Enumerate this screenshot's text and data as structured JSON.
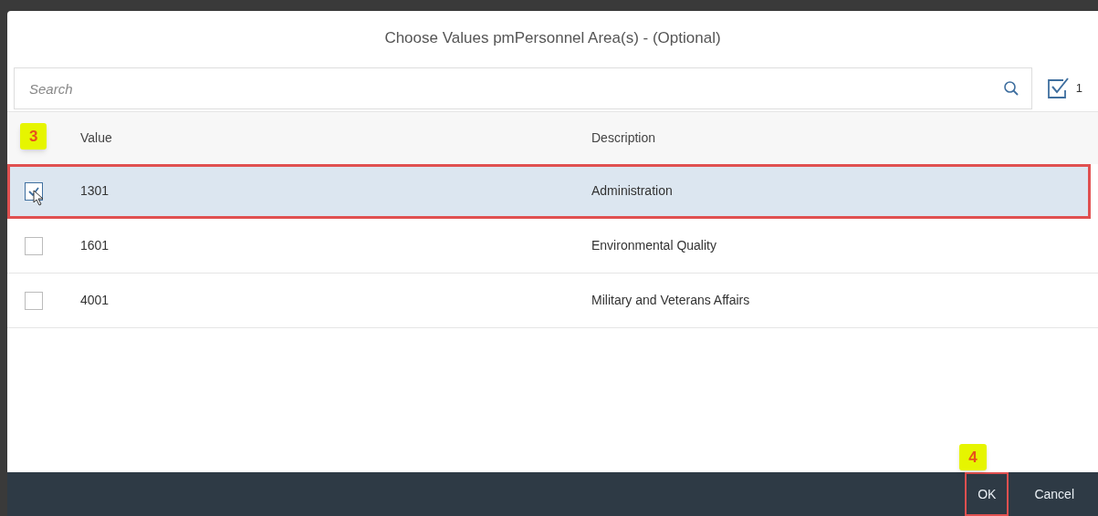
{
  "dialog": {
    "title": "Choose Values pmPersonnel Area(s) - (Optional)"
  },
  "search": {
    "placeholder": "Search"
  },
  "selected_count": "1",
  "table": {
    "columns": [
      "Value",
      "Description"
    ],
    "rows": [
      {
        "value": "1301",
        "description": "Administration",
        "checked": true,
        "selected": true,
        "highlighted": true
      },
      {
        "value": "1601",
        "description": "Environmental Quality",
        "checked": false,
        "selected": false,
        "highlighted": false
      },
      {
        "value": "4001",
        "description": "Military and Veterans Affairs",
        "checked": false,
        "selected": false,
        "highlighted": false
      }
    ]
  },
  "step_badges": [
    {
      "label": "3"
    },
    {
      "label": "4"
    }
  ],
  "buttons": [
    {
      "label": "OK",
      "highlighted": true
    },
    {
      "label": "Cancel",
      "highlighted": false
    }
  ]
}
